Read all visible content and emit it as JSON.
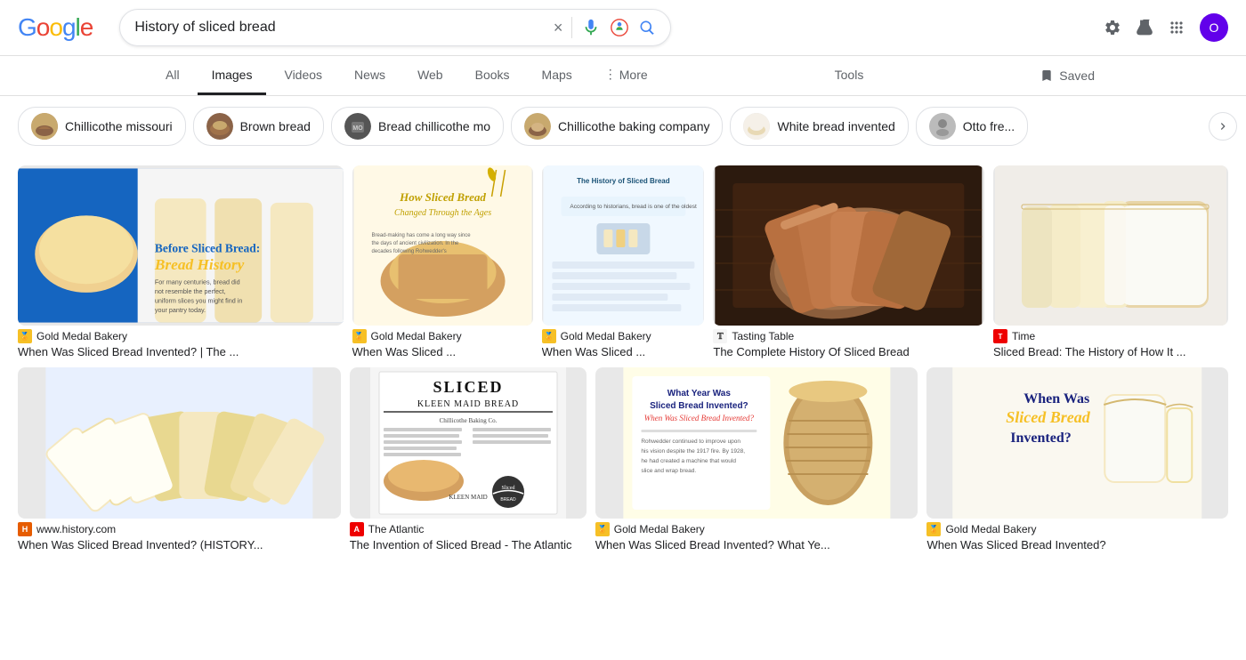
{
  "header": {
    "search_query": "History of sliced bread",
    "clear_label": "×",
    "avatar_letter": "O"
  },
  "nav": {
    "tabs": [
      {
        "label": "All",
        "active": false
      },
      {
        "label": "Images",
        "active": true
      },
      {
        "label": "Videos",
        "active": false
      },
      {
        "label": "News",
        "active": false
      },
      {
        "label": "Web",
        "active": false
      },
      {
        "label": "Books",
        "active": false
      },
      {
        "label": "Maps",
        "active": false
      },
      {
        "label": "More",
        "active": false,
        "has_dots": true
      },
      {
        "label": "Tools",
        "active": false
      },
      {
        "label": "Saved",
        "active": false
      }
    ]
  },
  "filters": {
    "chips": [
      {
        "label": "Chillicothe missouri",
        "thumb_color": "#c8a96e"
      },
      {
        "label": "Brown bread",
        "thumb_color": "#8B6347"
      },
      {
        "label": "Bread chillicothe mo",
        "thumb_color": "#555"
      },
      {
        "label": "Chillicothe baking company",
        "thumb_color": "#c8a96e"
      },
      {
        "label": "White bread invented",
        "thumb_color": "#f0d9a0"
      },
      {
        "label": "Otto fre...",
        "thumb_color": "#999"
      }
    ]
  },
  "row1": {
    "cards": [
      {
        "title": "When Was Sliced Bread Invented? | The ...",
        "source_name": "Gold Medal Bakery",
        "source_icon_type": "gold",
        "source_icon_label": "🏅",
        "bg_type": "blue"
      },
      {
        "title": "When Was Sliced ...",
        "source_name": "Gold Medal Bakery",
        "source_icon_type": "gold",
        "source_icon_label": "🏅",
        "bg_type": "yellow"
      },
      {
        "title": "When Was Sliced ...",
        "source_name": "Gold Medal Bakery",
        "source_icon_type": "gold",
        "source_icon_label": "🏅",
        "bg_type": "info"
      },
      {
        "title": "The Complete History Of Sliced Bread",
        "source_name": "Tasting Table",
        "source_icon_type": "t",
        "source_icon_label": "T",
        "bg_type": "dark"
      },
      {
        "title": "Sliced Bread: The History of How It ...",
        "source_name": "Time",
        "source_icon_type": "time",
        "source_icon_label": "T",
        "bg_type": "white"
      }
    ]
  },
  "row2": {
    "cards": [
      {
        "title": "When Was Sliced Bread Invented? (HISTORY...",
        "source_name": "www.history.com",
        "source_icon_type": "history",
        "source_icon_label": "H",
        "bg_type": "blue2"
      },
      {
        "title": "The Invention of Sliced Bread - The Atlantic",
        "source_name": "The Atlantic",
        "source_icon_type": "atlantic",
        "source_icon_label": "A",
        "bg_type": "news"
      },
      {
        "title": "When Was Sliced Bread Invented? What Ye...",
        "source_name": "Gold Medal Bakery",
        "source_icon_type": "gold",
        "source_icon_label": "🏅",
        "bg_type": "info2"
      },
      {
        "title": "When Was Sliced Bread Invented?",
        "source_name": "Gold Medal Bakery",
        "source_icon_type": "gold",
        "source_icon_label": "🏅",
        "bg_type": "cream"
      }
    ]
  }
}
